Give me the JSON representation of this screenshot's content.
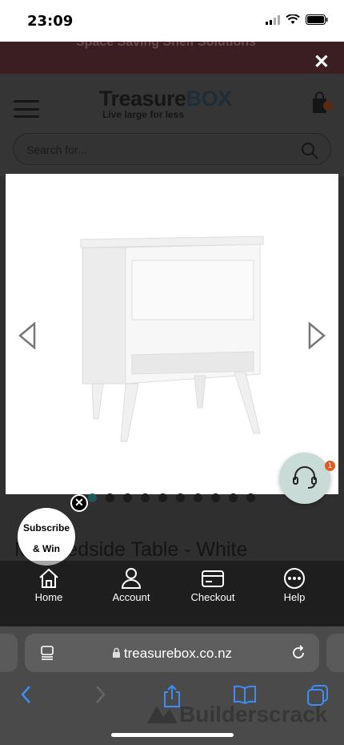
{
  "status_bar": {
    "time": "23:09"
  },
  "promo": {
    "text": "Space Saving Shelf Solutions"
  },
  "header": {
    "logo_main": "Treasure",
    "logo_box": "BOX",
    "logo_tagline": "Live large for less",
    "cart_count": "0"
  },
  "search": {
    "placeholder": "Search for..."
  },
  "carousel": {
    "dot_count": 10,
    "active_index": 0
  },
  "product": {
    "title": "M    n Bedside Table - White"
  },
  "support": {
    "badge": "1"
  },
  "subscribe": {
    "line1": "Subscribe",
    "line2": "& Win"
  },
  "bottom_nav": {
    "items": [
      {
        "label": "Home",
        "icon": "home-icon"
      },
      {
        "label": "Account",
        "icon": "user-icon"
      },
      {
        "label": "Checkout",
        "icon": "card-icon"
      },
      {
        "label": "Help",
        "icon": "more-icon"
      }
    ]
  },
  "browser": {
    "url": "treasurebox.co.nz"
  },
  "watermark": {
    "text": "Builderscrack"
  },
  "colors": {
    "accent": "#1c5a5a",
    "promo_bg": "#3a1e22",
    "support_bg": "#c9dbd6",
    "badge": "#e25b1e"
  }
}
